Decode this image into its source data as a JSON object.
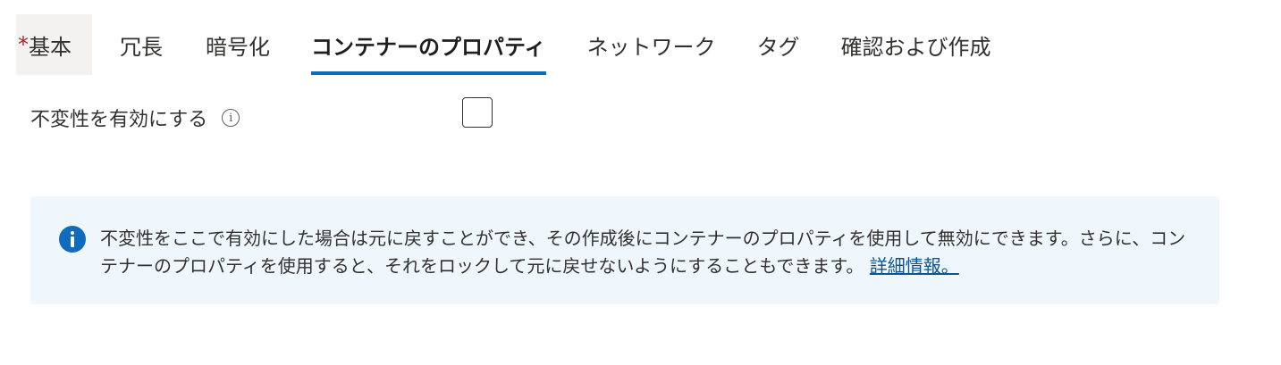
{
  "tabs": [
    {
      "required_marker": "*",
      "label": "基本"
    },
    {
      "label": "冗長"
    },
    {
      "label": "暗号化"
    },
    {
      "label": "コンテナーのプロパティ",
      "active": true
    },
    {
      "label": "ネットワーク"
    },
    {
      "label": "タグ"
    },
    {
      "label": "確認および作成"
    }
  ],
  "immutability": {
    "label": "不変性を有効にする",
    "info_icon": "info-icon",
    "checked": false
  },
  "info_bar": {
    "icon": "info-icon",
    "message": "不変性をここで有効にした場合は元に戻すことができ、その作成後にコンテナーのプロパティを使用して無効にできます。さらに、コンテナーのプロパティを使用すると、それをロックして元に戻せないようにすることもできます。",
    "link_text": "詳細情報。"
  },
  "colors": {
    "accent": "#0f6cbd",
    "required": "#a4262c",
    "info_background": "#eff6fc",
    "link": "#0f548c"
  }
}
